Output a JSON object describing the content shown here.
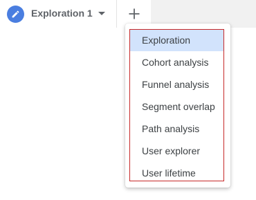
{
  "tab": {
    "title": "Exploration 1"
  },
  "add_tab": {
    "icon": "plus-icon"
  },
  "menu": {
    "items": [
      {
        "label": "Exploration",
        "selected": true
      },
      {
        "label": "Cohort analysis",
        "selected": false
      },
      {
        "label": "Funnel analysis",
        "selected": false
      },
      {
        "label": "Segment overlap",
        "selected": false
      },
      {
        "label": "Path analysis",
        "selected": false
      },
      {
        "label": "User explorer",
        "selected": false
      },
      {
        "label": "User lifetime",
        "selected": false
      }
    ]
  },
  "colors": {
    "accent": "#4a7ee0",
    "selected_bg": "#d2e3fc",
    "annotation_border": "#c62828"
  }
}
